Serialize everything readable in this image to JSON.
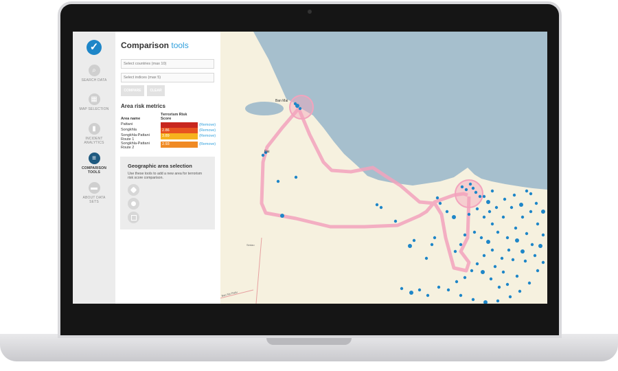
{
  "nav": {
    "items": [
      {
        "label": "SEARCH DATA",
        "icon": "search-icon"
      },
      {
        "label": "MAP SELECTION",
        "icon": "map-icon"
      },
      {
        "label": "INCIDENT ANALYTICS",
        "icon": "chart-icon"
      },
      {
        "label": "COMPARISON TOOLS",
        "icon": "sliders-icon",
        "active": true
      },
      {
        "label": "ABOUT DATA SETS",
        "icon": "speech-bubble-icon"
      }
    ]
  },
  "panel": {
    "title_main": "Comparison",
    "title_accent": "tools",
    "countries_placeholder": "Select countries (max 10)",
    "indices_placeholder": "Select indices (max 5)",
    "compare_label": "COMPARE",
    "clear_label": "CLEAR",
    "metrics_title": "Area risk metrics",
    "col_area": "Area name",
    "col_score": "Terrorism Risk Score",
    "rows": [
      {
        "name": "Pattani",
        "score": "",
        "remove": "(Remove)",
        "color": "#c8261e"
      },
      {
        "name": "Songkhla",
        "score": "2.86",
        "remove": "(Remove)",
        "color": "#e8531f"
      },
      {
        "name": "Songkhla-Pattani Route 1",
        "score": "3.89",
        "remove": "(Remove)",
        "color": "#f6b21e"
      },
      {
        "name": "Songkhla-Pattani Route 2",
        "score": "2.93",
        "remove": "(Remove)",
        "color": "#f08a24"
      }
    ],
    "geo_title": "Geographic area selection",
    "geo_desc": "Use these tools to add a new area for terrorism risk score comparison."
  },
  "map": {
    "labels": {
      "ban_mai": "Ban Mai",
      "left_town": "Dai",
      "mid_town": "Sedao",
      "road": "Ban Na Padu"
    },
    "colors": {
      "sea": "#a6bfcd",
      "land": "#f6f1df",
      "route": "#f3a3bd",
      "incident": "#1e86c8"
    }
  }
}
